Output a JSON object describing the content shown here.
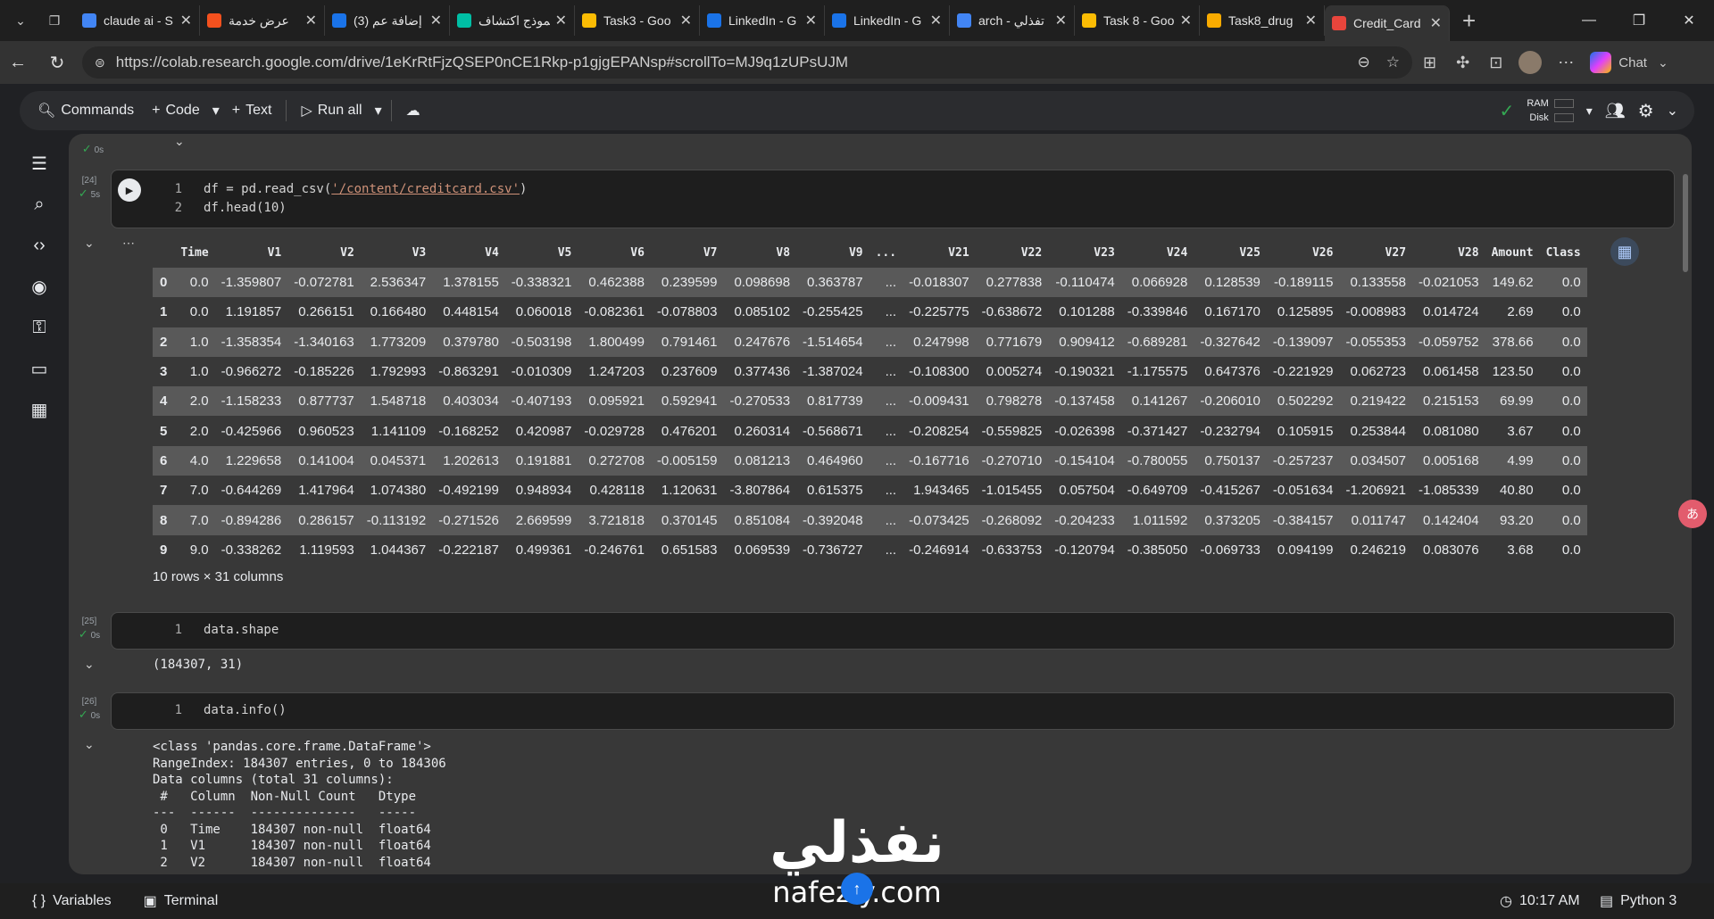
{
  "browser": {
    "tabs": [
      {
        "label": "claude ai - S",
        "color": "#4285f4"
      },
      {
        "label": "عرض خدمة",
        "color": "#f4511e"
      },
      {
        "label": "(3) إضافة عم",
        "color": "#1a73e8"
      },
      {
        "label": "نموذج اكتشاف",
        "color": "#00bfa5"
      },
      {
        "label": "Task3 - Goo",
        "color": "#fbbc04"
      },
      {
        "label": "LinkedIn - G",
        "color": "#1a73e8"
      },
      {
        "label": "LinkedIn - G",
        "color": "#1a73e8"
      },
      {
        "label": "arch - تفذلي",
        "color": "#4285f4"
      },
      {
        "label": "Task 8 - Goo",
        "color": "#fbbc04"
      },
      {
        "label": "Task8_drug",
        "color": "#f9ab00"
      },
      {
        "label": "Credit_Card",
        "color": "#e8453c"
      }
    ],
    "url": "https://colab.research.google.com/drive/1eKrRtFjzQSEP0nCE1Rkp-p1gjgEPANsp#scrollTo=MJ9q1zUPsUJM",
    "chat_label": "Chat"
  },
  "toolbar": {
    "commands": "Commands",
    "code": "Code",
    "text": "Text",
    "run_all": "Run all",
    "ram": "RAM",
    "disk": "Disk"
  },
  "cells": {
    "prev_status": "0s",
    "cell24": {
      "num": "[24]",
      "time": "5s",
      "lines": [
        "1",
        "2"
      ],
      "code_pre": "df = pd.read_csv(",
      "code_str": "'/content/creditcard.csv'",
      "code_post": ")",
      "code2": "df.head(10)"
    },
    "cell25": {
      "num": "[25]",
      "time": "0s",
      "line": "1",
      "code": "data.shape",
      "output": "(184307, 31)"
    },
    "cell26": {
      "num": "[26]",
      "time": "0s",
      "line": "1",
      "code": "data.info()",
      "output": "<class 'pandas.core.frame.DataFrame'>\nRangeIndex: 184307 entries, 0 to 184306\nData columns (total 31 columns):\n #   Column  Non-Null Count   Dtype  \n---  ------  --------------   -----  \n 0   Time    184307 non-null  float64\n 1   V1      184307 non-null  float64\n 2   V2      184307 non-null  float64"
    }
  },
  "dataframe": {
    "columns": [
      "",
      "Time",
      "V1",
      "V2",
      "V3",
      "V4",
      "V5",
      "V6",
      "V7",
      "V8",
      "V9",
      "...",
      "V21",
      "V22",
      "V23",
      "V24",
      "V25",
      "V26",
      "V27",
      "V28",
      "Amount",
      "Class"
    ],
    "rows": [
      [
        "0",
        "0.0",
        "-1.359807",
        "-0.072781",
        "2.536347",
        "1.378155",
        "-0.338321",
        "0.462388",
        "0.239599",
        "0.098698",
        "0.363787",
        "...",
        "-0.018307",
        "0.277838",
        "-0.110474",
        "0.066928",
        "0.128539",
        "-0.189115",
        "0.133558",
        "-0.021053",
        "149.62",
        "0.0"
      ],
      [
        "1",
        "0.0",
        "1.191857",
        "0.266151",
        "0.166480",
        "0.448154",
        "0.060018",
        "-0.082361",
        "-0.078803",
        "0.085102",
        "-0.255425",
        "...",
        "-0.225775",
        "-0.638672",
        "0.101288",
        "-0.339846",
        "0.167170",
        "0.125895",
        "-0.008983",
        "0.014724",
        "2.69",
        "0.0"
      ],
      [
        "2",
        "1.0",
        "-1.358354",
        "-1.340163",
        "1.773209",
        "0.379780",
        "-0.503198",
        "1.800499",
        "0.791461",
        "0.247676",
        "-1.514654",
        "...",
        "0.247998",
        "0.771679",
        "0.909412",
        "-0.689281",
        "-0.327642",
        "-0.139097",
        "-0.055353",
        "-0.059752",
        "378.66",
        "0.0"
      ],
      [
        "3",
        "1.0",
        "-0.966272",
        "-0.185226",
        "1.792993",
        "-0.863291",
        "-0.010309",
        "1.247203",
        "0.237609",
        "0.377436",
        "-1.387024",
        "...",
        "-0.108300",
        "0.005274",
        "-0.190321",
        "-1.175575",
        "0.647376",
        "-0.221929",
        "0.062723",
        "0.061458",
        "123.50",
        "0.0"
      ],
      [
        "4",
        "2.0",
        "-1.158233",
        "0.877737",
        "1.548718",
        "0.403034",
        "-0.407193",
        "0.095921",
        "0.592941",
        "-0.270533",
        "0.817739",
        "...",
        "-0.009431",
        "0.798278",
        "-0.137458",
        "0.141267",
        "-0.206010",
        "0.502292",
        "0.219422",
        "0.215153",
        "69.99",
        "0.0"
      ],
      [
        "5",
        "2.0",
        "-0.425966",
        "0.960523",
        "1.141109",
        "-0.168252",
        "0.420987",
        "-0.029728",
        "0.476201",
        "0.260314",
        "-0.568671",
        "...",
        "-0.208254",
        "-0.559825",
        "-0.026398",
        "-0.371427",
        "-0.232794",
        "0.105915",
        "0.253844",
        "0.081080",
        "3.67",
        "0.0"
      ],
      [
        "6",
        "4.0",
        "1.229658",
        "0.141004",
        "0.045371",
        "1.202613",
        "0.191881",
        "0.272708",
        "-0.005159",
        "0.081213",
        "0.464960",
        "...",
        "-0.167716",
        "-0.270710",
        "-0.154104",
        "-0.780055",
        "0.750137",
        "-0.257237",
        "0.034507",
        "0.005168",
        "4.99",
        "0.0"
      ],
      [
        "7",
        "7.0",
        "-0.644269",
        "1.417964",
        "1.074380",
        "-0.492199",
        "0.948934",
        "0.428118",
        "1.120631",
        "-3.807864",
        "0.615375",
        "...",
        "1.943465",
        "-1.015455",
        "0.057504",
        "-0.649709",
        "-0.415267",
        "-0.051634",
        "-1.206921",
        "-1.085339",
        "40.80",
        "0.0"
      ],
      [
        "8",
        "7.0",
        "-0.894286",
        "0.286157",
        "-0.113192",
        "-0.271526",
        "2.669599",
        "3.721818",
        "0.370145",
        "0.851084",
        "-0.392048",
        "...",
        "-0.073425",
        "-0.268092",
        "-0.204233",
        "1.011592",
        "0.373205",
        "-0.384157",
        "0.011747",
        "0.142404",
        "93.20",
        "0.0"
      ],
      [
        "9",
        "9.0",
        "-0.338262",
        "1.119593",
        "1.044367",
        "-0.222187",
        "0.499361",
        "-0.246761",
        "0.651583",
        "0.069539",
        "-0.736727",
        "...",
        "-0.246914",
        "-0.633753",
        "-0.120794",
        "-0.385050",
        "-0.069733",
        "0.094199",
        "0.246219",
        "0.083076",
        "3.68",
        "0.0"
      ]
    ],
    "footer": "10 rows × 31 columns"
  },
  "statusbar": {
    "variables": "Variables",
    "terminal": "Terminal",
    "time": "10:17 AM",
    "kernel": "Python 3"
  },
  "watermark": {
    "arabic": "نفذلي",
    "latin": "nafezly.com"
  }
}
